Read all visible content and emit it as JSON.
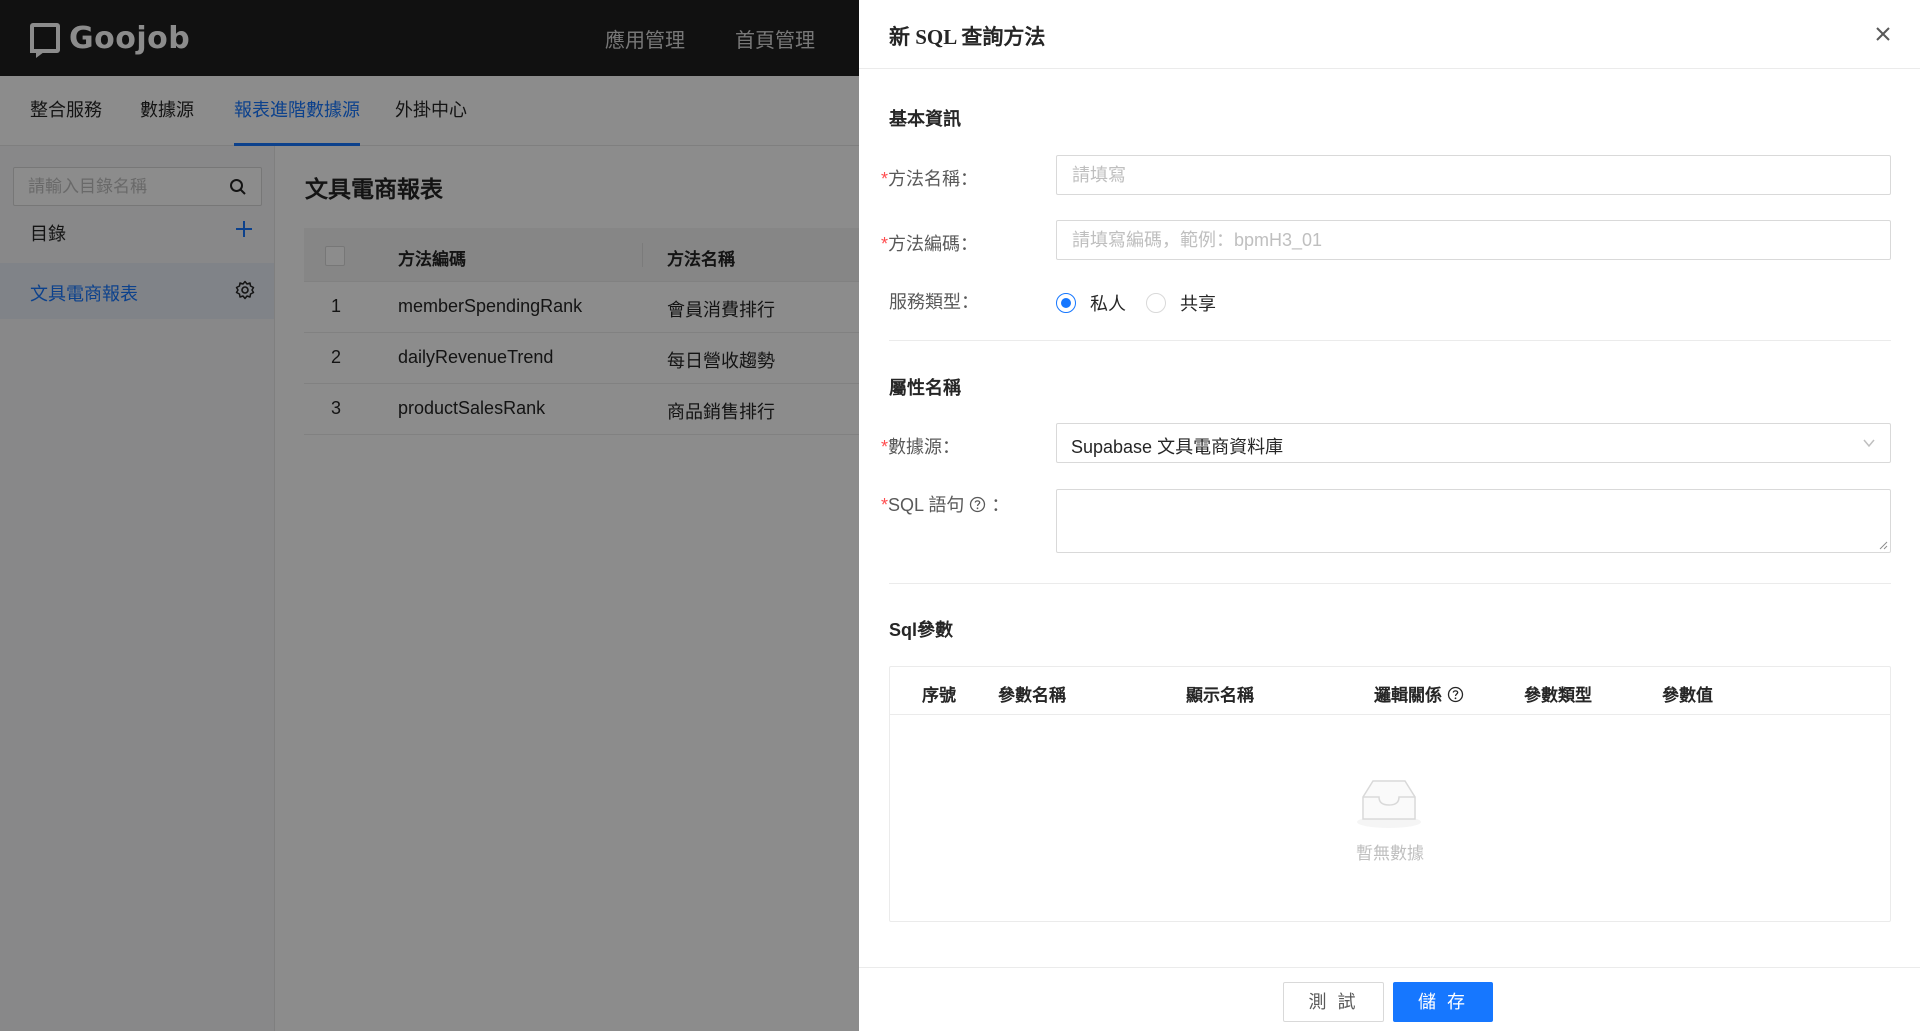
{
  "header": {
    "logo_text": "Goojob",
    "nav": [
      "應用管理",
      "首頁管理"
    ]
  },
  "subtabs": {
    "items": [
      "整合服務",
      "數據源",
      "報表進階數據源",
      "外掛中心"
    ],
    "active": "報表進階數據源"
  },
  "sidebar": {
    "search_placeholder": "請輸入目錄名稱",
    "title": "目錄",
    "items": [
      {
        "label": "文具電商報表"
      }
    ]
  },
  "main": {
    "title": "文具電商報表",
    "columns": [
      "方法編碼",
      "方法名稱"
    ],
    "rows": [
      {
        "index": "1",
        "code": "memberSpendingRank",
        "name": "會員消費排行"
      },
      {
        "index": "2",
        "code": "dailyRevenueTrend",
        "name": "每日營收趨勢"
      },
      {
        "index": "3",
        "code": "productSalesRank",
        "name": "商品銷售排行"
      }
    ]
  },
  "drawer": {
    "title": "新 SQL 查詢方法",
    "basic_section": "基本資訊",
    "method_name": {
      "label": "方法名稱：",
      "placeholder": "請填寫",
      "value": ""
    },
    "method_code": {
      "label": "方法編碼：",
      "placeholder": "請填寫編碼，範例：bpmH3_01",
      "value": ""
    },
    "service_type": {
      "label": "服務類型：",
      "options": [
        "私人",
        "共享"
      ],
      "selected": "私人"
    },
    "attr_section": "屬性名稱",
    "datasource": {
      "label": "數據源：",
      "value": "Supabase 文具電商資料庫"
    },
    "sql": {
      "label": "SQL 語句",
      "colon": "：",
      "value": ""
    },
    "params_section": "Sql參數",
    "params_columns": [
      "序號",
      "參數名稱",
      "顯示名稱",
      "邏輯關係",
      "參數類型",
      "參數值"
    ],
    "params_empty": "暫無數據",
    "test_label": "測 試",
    "save_label": "儲 存"
  },
  "colors": {
    "accent": "#1677ff",
    "header_bg": "#1f1f1f",
    "required": "#ff4d4f"
  }
}
